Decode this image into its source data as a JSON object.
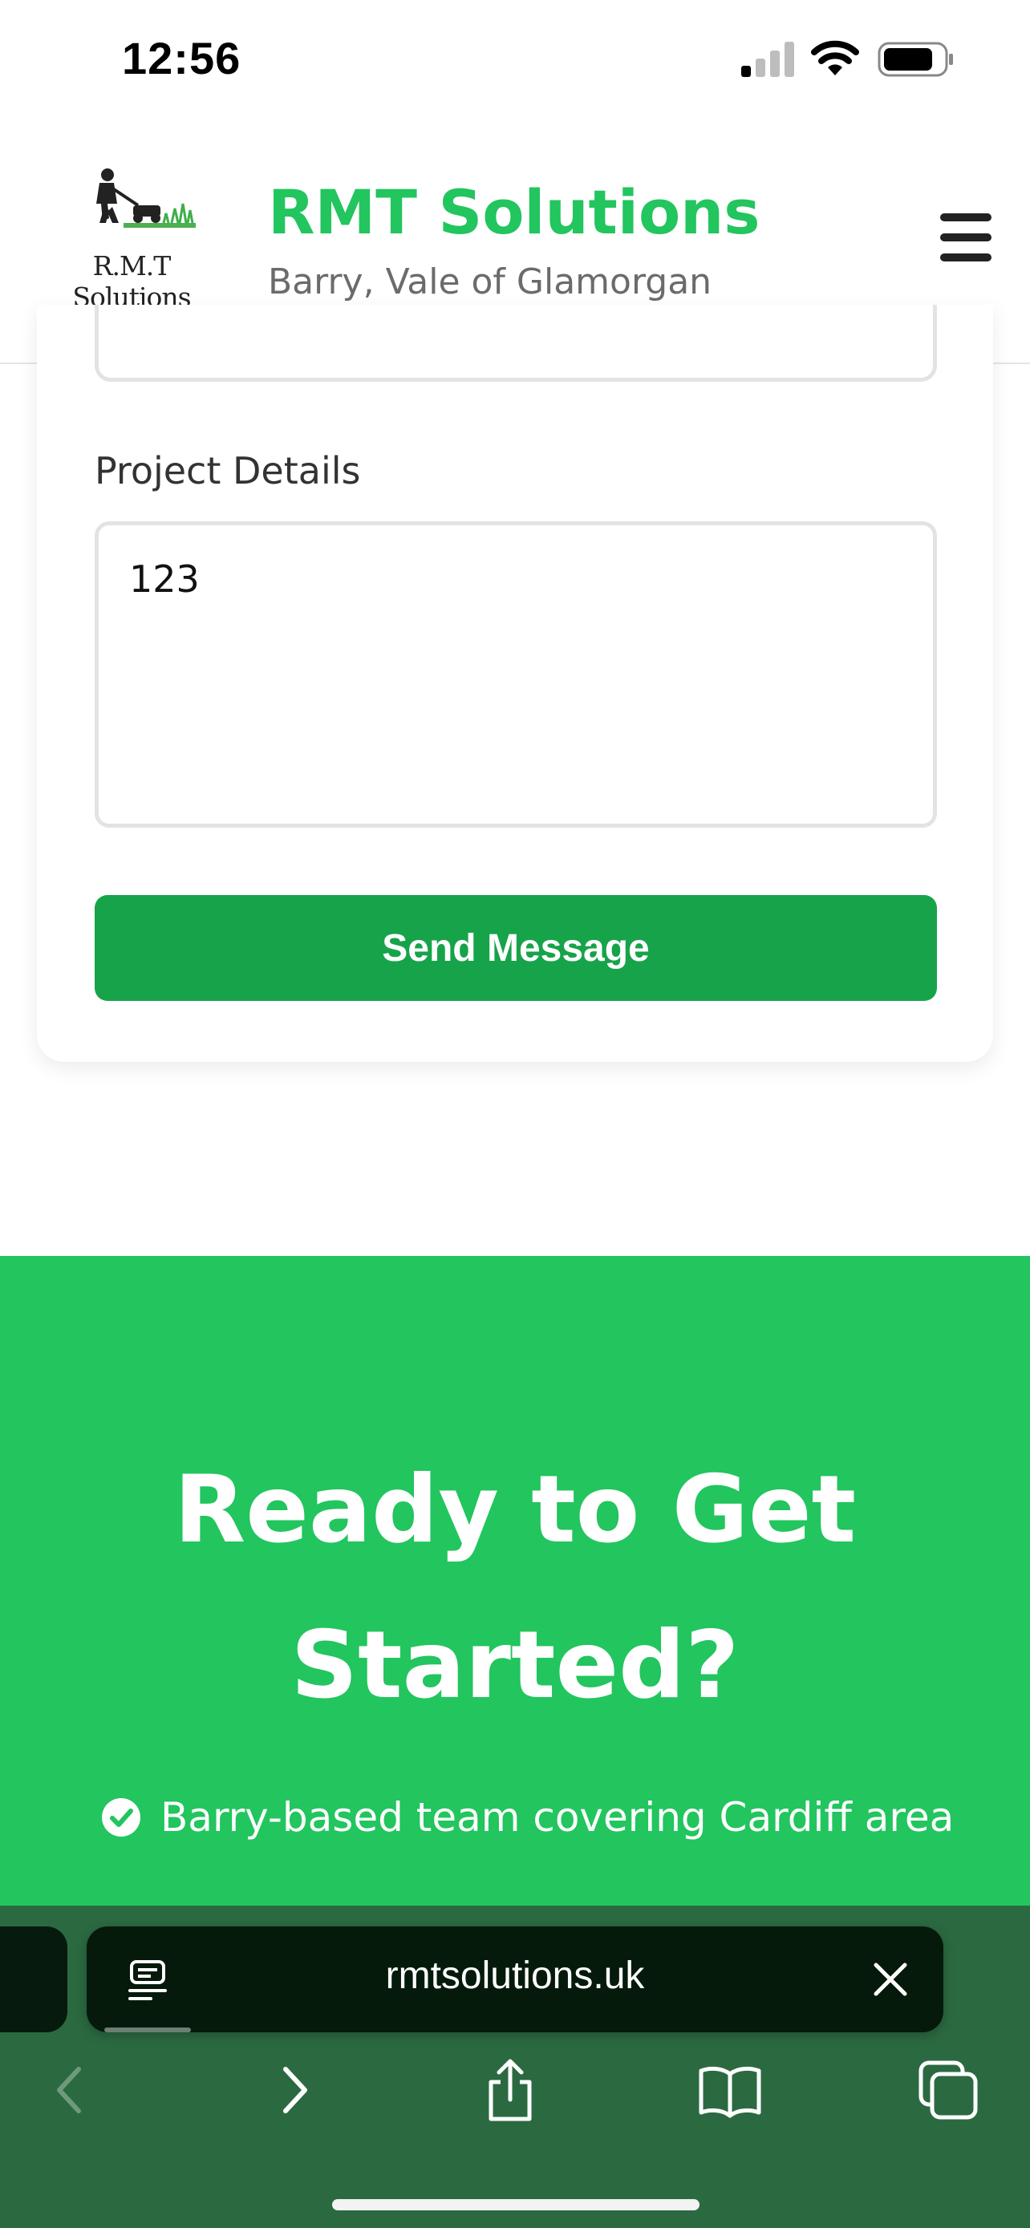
{
  "status_bar": {
    "time": "12:56",
    "signal_icon": "signal-icon",
    "wifi_icon": "wifi-icon",
    "battery_icon": "battery-icon"
  },
  "header": {
    "logo_text": "R.M.T Solutions",
    "brand_name": "RMT Solutions",
    "location": "Barry, Vale of Glamorgan",
    "menu_icon": "hamburger-menu-icon",
    "brand_color": "#22c55e"
  },
  "contact_form": {
    "project_details_label": "Project Details",
    "project_details_value": "123",
    "send_button_label": "Send Message",
    "button_color": "#17a34a"
  },
  "cta": {
    "title": "Ready to Get Started?",
    "features": [
      {
        "icon": "check-circle-icon",
        "text": "Barry-based team covering Cardiff area"
      }
    ],
    "background_color": "#22c55e"
  },
  "browser": {
    "url": "rmtsolutions.uk",
    "toolbar_color": "#2b6a41",
    "icons": [
      "reader-icon",
      "close-icon",
      "back-icon",
      "forward-icon",
      "share-icon",
      "bookmarks-icon",
      "tabs-icon"
    ]
  }
}
